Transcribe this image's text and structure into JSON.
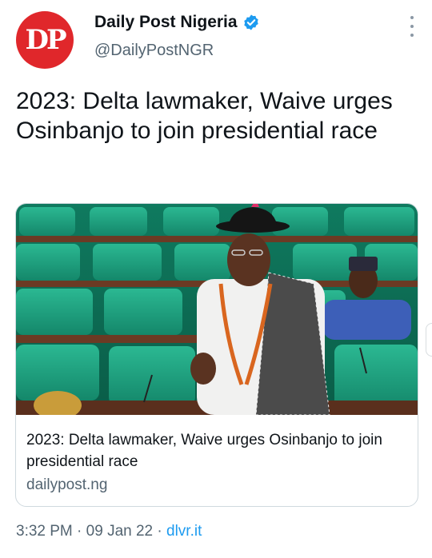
{
  "tweet": {
    "avatar_text": "DP",
    "display_name": "Daily Post Nigeria",
    "handle": "@DailyPostNGR",
    "text": "2023: Delta lawmaker, Waive urges Osinbanjo to join presidential race",
    "verified": true
  },
  "card": {
    "title": "2023: Delta lawmaker, Waive urges Osinbanjo to join presidential race",
    "domain": "dailypost.ng",
    "image_description": "Lawmaker in black hat speaking in green-seated legislative chamber"
  },
  "meta": {
    "time": "3:32 PM",
    "separator": " · ",
    "date": "09 Jan 22",
    "source": "dlvr.it"
  },
  "colors": {
    "brand_red": "#e0272b",
    "link_blue": "#1d9bf0",
    "secondary_text": "#536471",
    "seat_green": "#1fa07d"
  },
  "icons": [
    "verified-badge-icon",
    "more-options-icon"
  ]
}
